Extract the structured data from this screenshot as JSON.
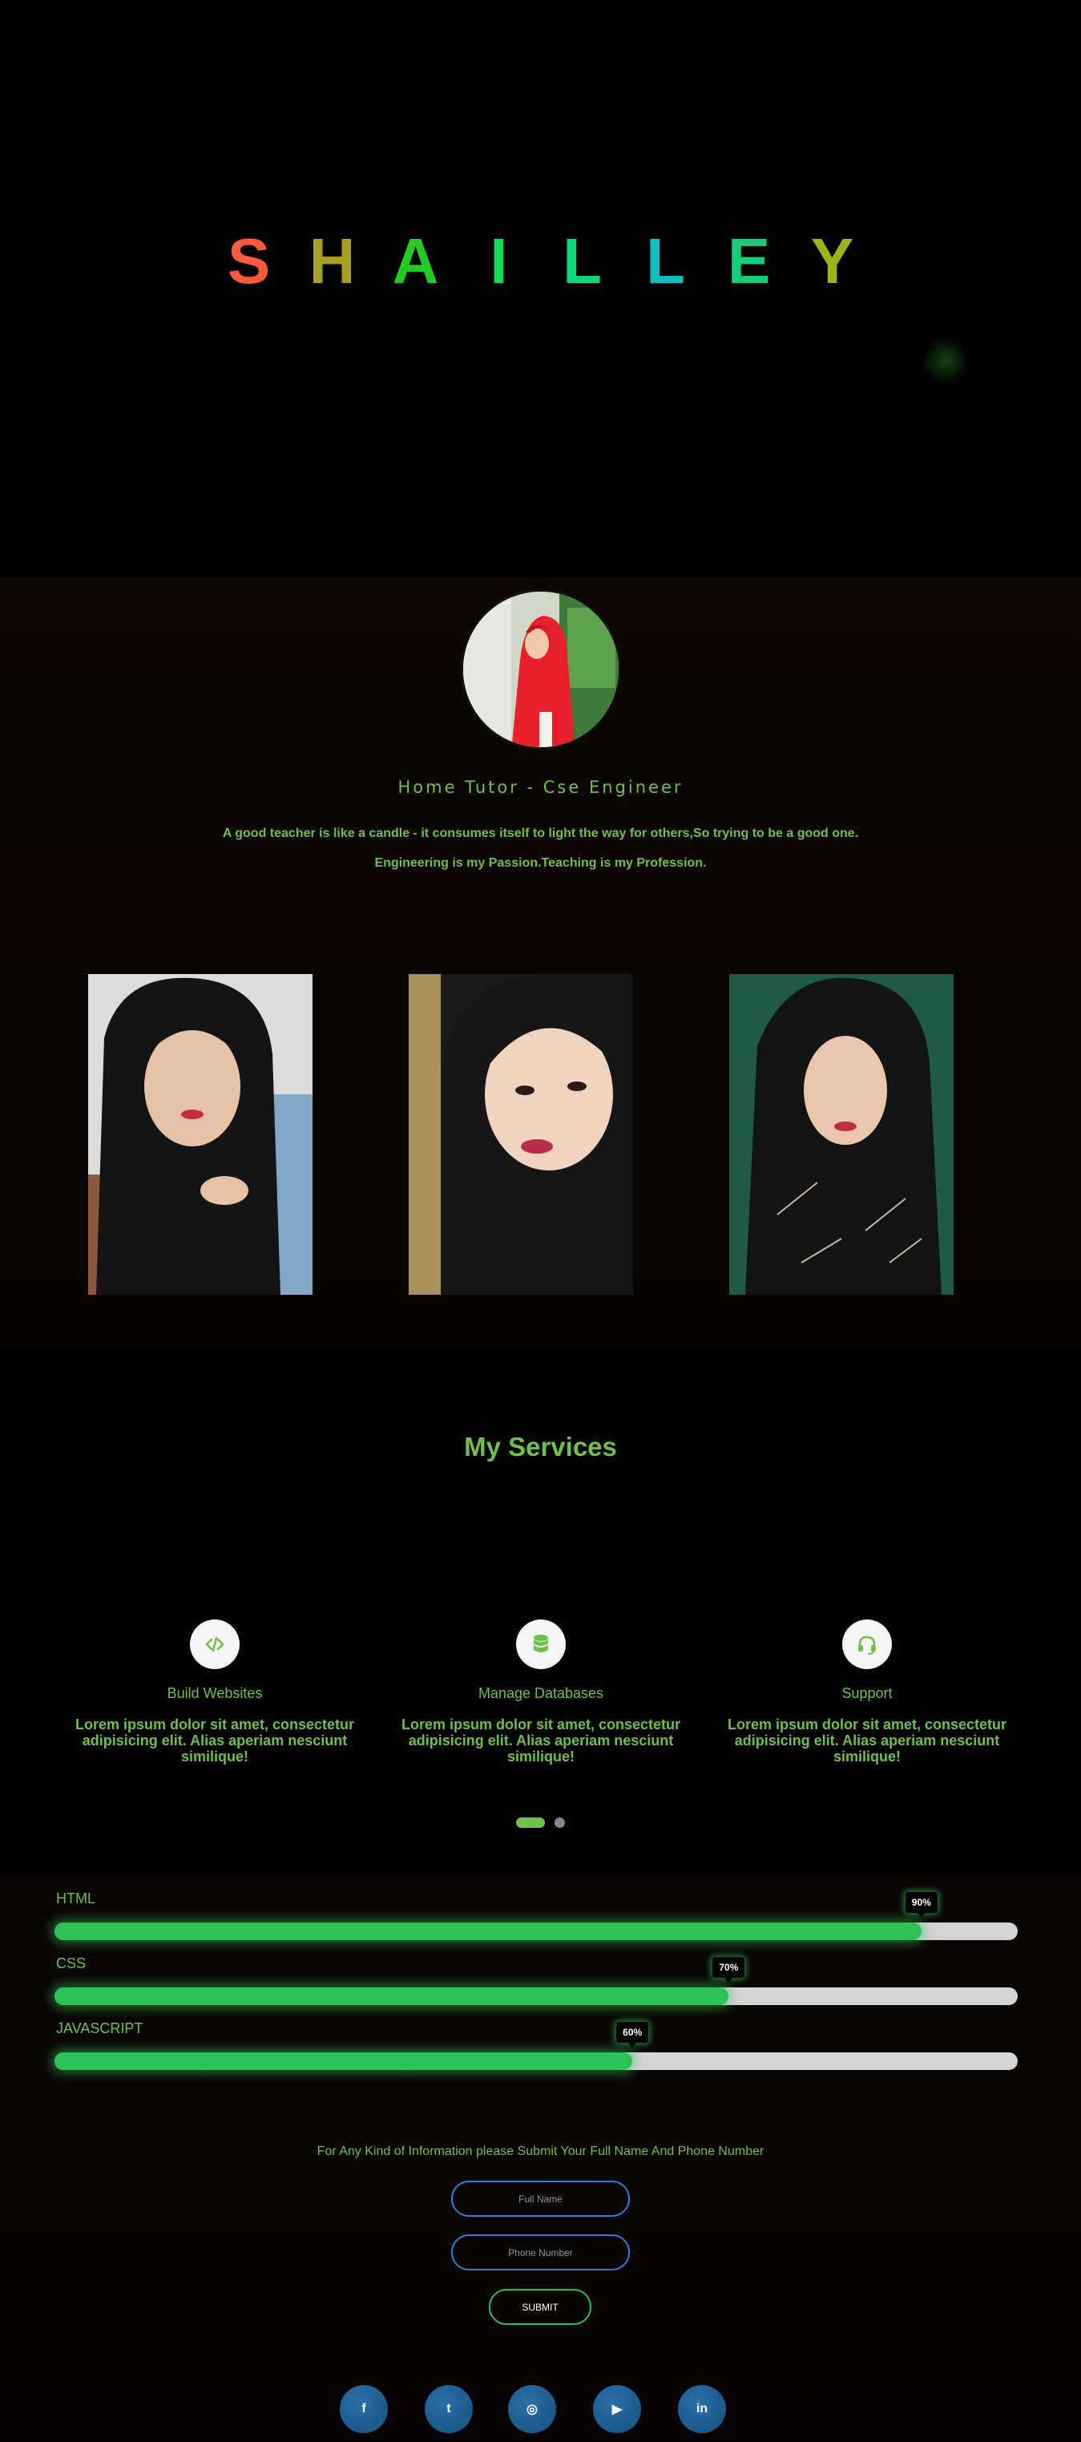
{
  "hero": {
    "letters": [
      {
        "char": "S",
        "color": "#ff5a3c"
      },
      {
        "char": "H",
        "color": "#a89f20"
      },
      {
        "char": "A",
        "color": "#22cc22"
      },
      {
        "char": "I",
        "color": "#11dd55"
      },
      {
        "char": "L",
        "color": "#11d57a"
      },
      {
        "char": "L",
        "color": "#10c0c0"
      },
      {
        "char": "E",
        "color": "#16cc7a"
      },
      {
        "char": "Y",
        "color": "#9ab41a"
      }
    ]
  },
  "about": {
    "subtitle": "Home Tutor - Cse Engineer",
    "quote_line1": "A good teacher is like a candle - it consumes itself to light the way for others,So trying to be a good one.",
    "quote_line2": "Engineering is my Passion.Teaching is my Profession."
  },
  "services": {
    "heading": "My Services",
    "items": [
      {
        "title": "Build Websites",
        "icon": "code-icon",
        "text": "Lorem ipsum dolor sit amet, consectetur adipisicing elit. Alias aperiam nesciunt similique!"
      },
      {
        "title": "Manage Databases",
        "icon": "database-icon",
        "text": "Lorem ipsum dolor sit amet, consectetur adipisicing elit. Alias aperiam nesciunt similique!"
      },
      {
        "title": "Support",
        "icon": "headset-icon",
        "text": "Lorem ipsum dolor sit amet, consectetur adipisicing elit. Alias aperiam nesciunt similique!"
      }
    ],
    "carousel_active_index": 0
  },
  "skills": [
    {
      "label": "HTML",
      "percent": 90,
      "badge": "90%"
    },
    {
      "label": "CSS",
      "percent": 70,
      "badge": "70%"
    },
    {
      "label": "JAVASCRIPT",
      "percent": 60,
      "badge": "60%"
    }
  ],
  "contact": {
    "note": "For Any Kind of Information please Submit Your Full Name And Phone Number",
    "name_placeholder": "Full Name",
    "phone_placeholder": "Phone Number",
    "submit_label": "SUBMIT"
  },
  "social": [
    {
      "icon": "facebook-icon",
      "glyph": "f"
    },
    {
      "icon": "twitter-icon",
      "glyph": "t"
    },
    {
      "icon": "instagram-icon",
      "glyph": "◎"
    },
    {
      "icon": "youtube-icon",
      "glyph": "▶"
    },
    {
      "icon": "linkedin-icon",
      "glyph": "in"
    }
  ],
  "colors": {
    "accent_green": "#6fbf4a",
    "bar_green": "#2fbf57",
    "input_border": "#2e7fd8",
    "social_blue": "#1a5a8c"
  }
}
